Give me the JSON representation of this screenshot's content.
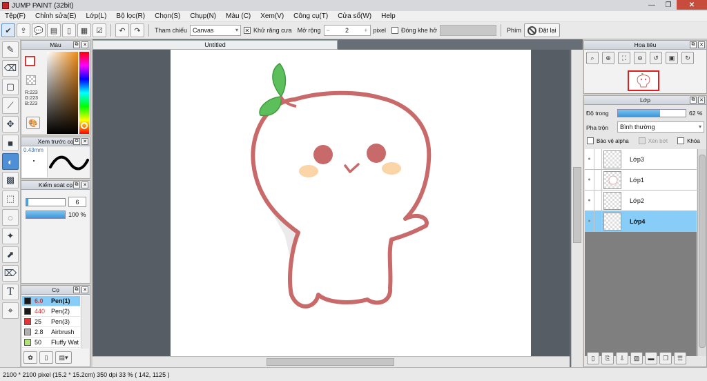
{
  "window": {
    "title": "JUMP PAINT (32bit)"
  },
  "menu": [
    "Tệp(F)",
    "Chỉnh sửa(E)",
    "Lớp(L)",
    "Bộ lọc(R)",
    "Chọn(S)",
    "Chụp(N)",
    "Màu (C)",
    "Xem(V)",
    "Công cụ(T)",
    "Cửa sổ(W)",
    "Help"
  ],
  "toolbar": {
    "reference_label": "Tham chiếu",
    "reference_value": "Canvas",
    "antialias_label": "Khử răng cưa",
    "expand_label": "Mở rộng",
    "expand_value": "2",
    "expand_unit": "pixel",
    "close_gap_label": "Đóng khe hở",
    "keys_label": "Phím",
    "reset_label": "Đặt lại"
  },
  "color_panel": {
    "title": "Màu",
    "r": "R:223",
    "g": "G:223",
    "b": "B:223",
    "primary": "#d23a3a"
  },
  "brush_preview": {
    "title": "Xem trước cọ",
    "size": "0.43mm"
  },
  "brush_control": {
    "title": "Kiểm soát cọ",
    "size_value": "6",
    "opacity_value": "100 %",
    "opacity": 100
  },
  "brush_panel": {
    "title": "Cọ",
    "brushes": [
      {
        "color": "#1a1a1a",
        "size": "6.0",
        "name": "Pen(1)",
        "selected": true
      },
      {
        "color": "#1a1a1a",
        "size": "440",
        "name": "Pen(2)",
        "selected": false
      },
      {
        "color": "#e83434",
        "size": "25",
        "name": "Pen(3)",
        "selected": false
      },
      {
        "color": "#b0b0b0",
        "size": "2.8",
        "name": "Airbrush",
        "selected": false
      },
      {
        "color": "#b6e07a",
        "size": "50",
        "name": "Fluffy Wat",
        "selected": false
      }
    ]
  },
  "document": {
    "tab": "Untitled"
  },
  "navigator": {
    "title": "Hoa tiêu"
  },
  "layers": {
    "title": "Lớp",
    "opacity_label": "Độ trong",
    "opacity_value": "62 %",
    "opacity": 62,
    "blend_label": "Pha trộn",
    "blend_value": "Bình thường",
    "protect_alpha": "Bảo vệ alpha",
    "clip": "Xén bớt",
    "lock": "Khóa",
    "items": [
      {
        "name": "Lớp3",
        "selected": false
      },
      {
        "name": "Lớp1",
        "selected": false
      },
      {
        "name": "Lớp2",
        "selected": false
      },
      {
        "name": "Lớp4",
        "selected": true
      }
    ]
  },
  "status": {
    "size": "2100 * 2100 pixel",
    "physical": "(15.2 * 15.2cm)",
    "dpi": "350 dpi",
    "zoom": "33 %",
    "coords": "( 142, 1125 )"
  },
  "colors": {
    "accent": "#4f8fd6",
    "layer_selected": "#87cdf7",
    "character_outline": "#c96a6a",
    "leaf": "#5cbf5c"
  }
}
